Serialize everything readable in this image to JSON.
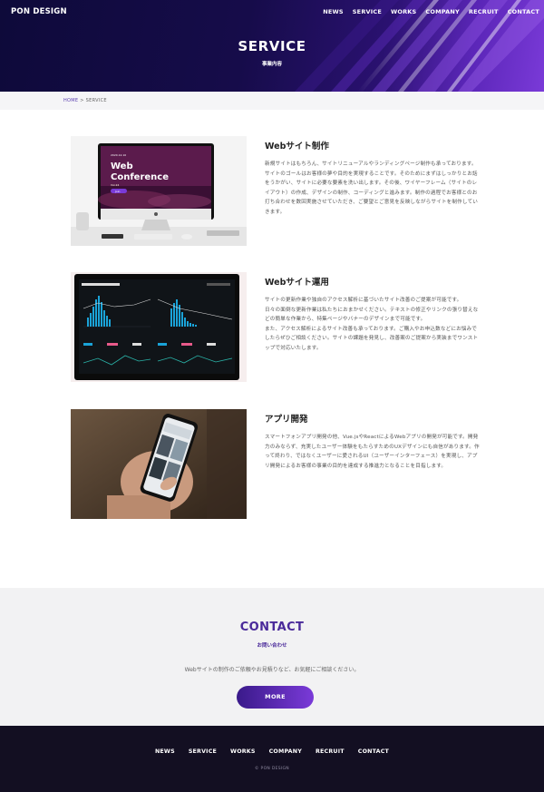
{
  "header": {
    "logo": "PON DESIGN",
    "nav": [
      "NEWS",
      "SERVICE",
      "WORKS",
      "COMPANY",
      "RECRUIT",
      "CONTACT"
    ]
  },
  "hero": {
    "title": "SERVICE",
    "subtitle": "事業内容"
  },
  "breadcrumb": {
    "home": "HOME",
    "separator": ">",
    "current": "SERVICE"
  },
  "services": [
    {
      "title": "Webサイト制作",
      "image": "imac-web-conference-photo",
      "image_text": {
        "date": "2020.12.10",
        "heading": "Web Conference",
        "sub": "Vol.24",
        "button": "Join"
      },
      "description": "新規サイトはもちろん、サイトリニューアルやランディングページ制作も承っております。\nサイトのゴールはお客様の夢や目的を実現することです。そのためにまずはしっかりとお話をうかがい、サイトに必要な要素を洗い出します。その後、ワイヤーフレーム（サイトのレイアウト）の作成、デザインの制作、コーディングと進みます。制作の過程でお客様とのお打ち合わせを数回実施させていただき、ご要望とご意見を反映しながらサイトを制作していきます。"
    },
    {
      "title": "Webサイト運用",
      "image": "analytics-dashboard-photo",
      "description": "サイトの更新作業や独自のアクセス解析に基づいたサイト改善のご提案が可能です。\n日々の面倒な更新作業は私たちにおまかせください。テキストの修正やリンクの張り替えなどの簡単な作業から、特集ページやバナーのデザインまで可能です。\nまた、アクセス解析によるサイト改善も承っております。ご購入やお申込数などにお悩みでしたらぜひご相談ください。サイトの課題を発見し、改善案のご提案から実装までワンストップで対応いたします。"
    },
    {
      "title": "アプリ開発",
      "image": "smartphone-in-hand-photo",
      "description": "スマートフォンアプリ開発の他、Vue.jsやReactによるWebアプリの開発が可能です。開発力のみならず、充実したユーザー体験をもたらすためのUXデザインにも自信があります。作って終わり、ではなくユーザーに愛されるUI（ユーザーインターフェース）を実現し、アプリ開発によるお客様の事業の目的を達成する推進力となることを目指します。"
    }
  ],
  "contact": {
    "title": "CONTACT",
    "subtitle": "お問い合わせ",
    "text": "Webサイトの制作のご依頼やお見積りなど、お気軽にご相談ください。",
    "button": "MORE"
  },
  "footer": {
    "nav": [
      "NEWS",
      "SERVICE",
      "WORKS",
      "COMPANY",
      "RECRUIT",
      "CONTACT"
    ],
    "copyright": "© PON DESIGN"
  },
  "colors": {
    "accent": "#4a2a9a",
    "hero_dark": "#0e0a3a",
    "hero_light": "#7a3ad8",
    "footer_bg": "#130f22",
    "contact_bg": "#f2f2f3"
  }
}
